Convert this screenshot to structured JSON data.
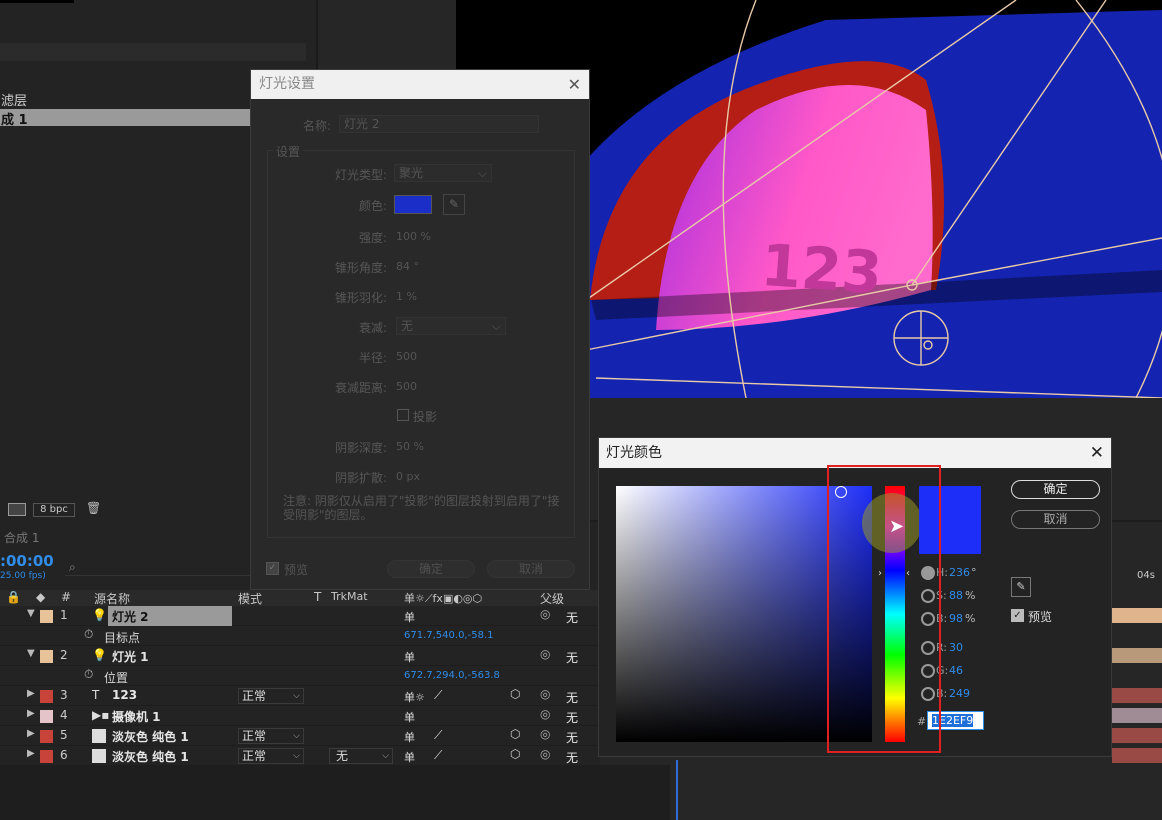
{
  "project": {
    "row1": "滤层",
    "row2": "成 1",
    "bpc": "8 bpc"
  },
  "timeline": {
    "tab": "合成 1",
    "time": ":00:00",
    "fps": "25.00 fps)",
    "ruler_04s": "04s",
    "headers": {
      "num": "#",
      "source": "源名称",
      "mode": "模式",
      "t": "T",
      "trkmat": "TrkMat",
      "parent": "父级"
    },
    "layers": [
      {
        "num": "1",
        "icon": "light-icon",
        "name": "灯光 2",
        "label_color": "#e8c39a",
        "parent": "无",
        "selected": true
      },
      {
        "num": "2",
        "icon": "light-icon",
        "name": "灯光 1",
        "label_color": "#e8c39a",
        "parent": "无"
      },
      {
        "num": "3",
        "icon": "text-icon",
        "name": "123",
        "label_color": "#c8443a",
        "mode": "正常",
        "parent": "无"
      },
      {
        "num": "4",
        "icon": "camera-icon",
        "name": "摄像机 1",
        "label_color": "#e4c4c8",
        "parent": "无"
      },
      {
        "num": "5",
        "icon": "solid-icon",
        "name": "淡灰色 纯色 1",
        "label_color": "#c8443a",
        "mode": "正常",
        "parent": "无"
      },
      {
        "num": "6",
        "icon": "solid-icon",
        "name": "淡灰色 纯色 1",
        "label_color": "#c8443a",
        "mode": "正常",
        "trkmat": "无",
        "parent": "无"
      }
    ],
    "props": {
      "target": {
        "name": "目标点",
        "value": "671.7,540.0,-58.1"
      },
      "position": {
        "name": "位置",
        "value": "672.7,294.0,-563.8"
      }
    },
    "track_colors": [
      "#e0b48c",
      "#b89a7a",
      "#9a4a44",
      "#a08c94",
      "#9a4a44",
      "#9a4a44"
    ]
  },
  "light_settings": {
    "title": "灯光设置",
    "name_label": "名称:",
    "name_value": "灯光 2",
    "group_label": "设置",
    "type_label": "灯光类型:",
    "type_value": "聚光",
    "color_label": "颜色:",
    "intensity_label": "强度:",
    "intensity_value": "100 %",
    "cone_angle_label": "锥形角度:",
    "cone_angle_value": "84 °",
    "cone_feather_label": "锥形羽化:",
    "cone_feather_value": "1 %",
    "falloff_label": "衰减:",
    "falloff_value": "无",
    "radius_label": "半径:",
    "radius_value": "500",
    "falloff_distance_label": "衰减距离:",
    "falloff_distance_value": "500",
    "shadow_label": "投影",
    "shadow_depth_label": "阴影深度:",
    "shadow_depth_value": "50 %",
    "shadow_diffusion_label": "阴影扩散:",
    "shadow_diffusion_value": "0 px",
    "note": "注意: 阴影仅从启用了\"投影\"的图层投射到启用了\"接受阴影\"的图层。",
    "preview_label": "预览",
    "ok_label": "确定",
    "cancel_label": "取消",
    "swatch_color": "#1b2ec8"
  },
  "light_color": {
    "title": "灯光颜色",
    "ok_label": "确定",
    "cancel_label": "取消",
    "preview_label": "预览",
    "H": {
      "label": "H:",
      "value": "236",
      "unit": "°"
    },
    "S": {
      "label": "S:",
      "value": "88",
      "unit": "%"
    },
    "B": {
      "label": "B:",
      "value": "98",
      "unit": "%"
    },
    "R": {
      "label": "R:",
      "value": "30"
    },
    "G": {
      "label": "G:",
      "value": "46"
    },
    "Bl": {
      "label": "B:",
      "value": "249"
    },
    "hash": "#",
    "hex": "1E2EF9",
    "current_color": "#1e2ef9"
  },
  "viewer": {
    "text": "123"
  }
}
